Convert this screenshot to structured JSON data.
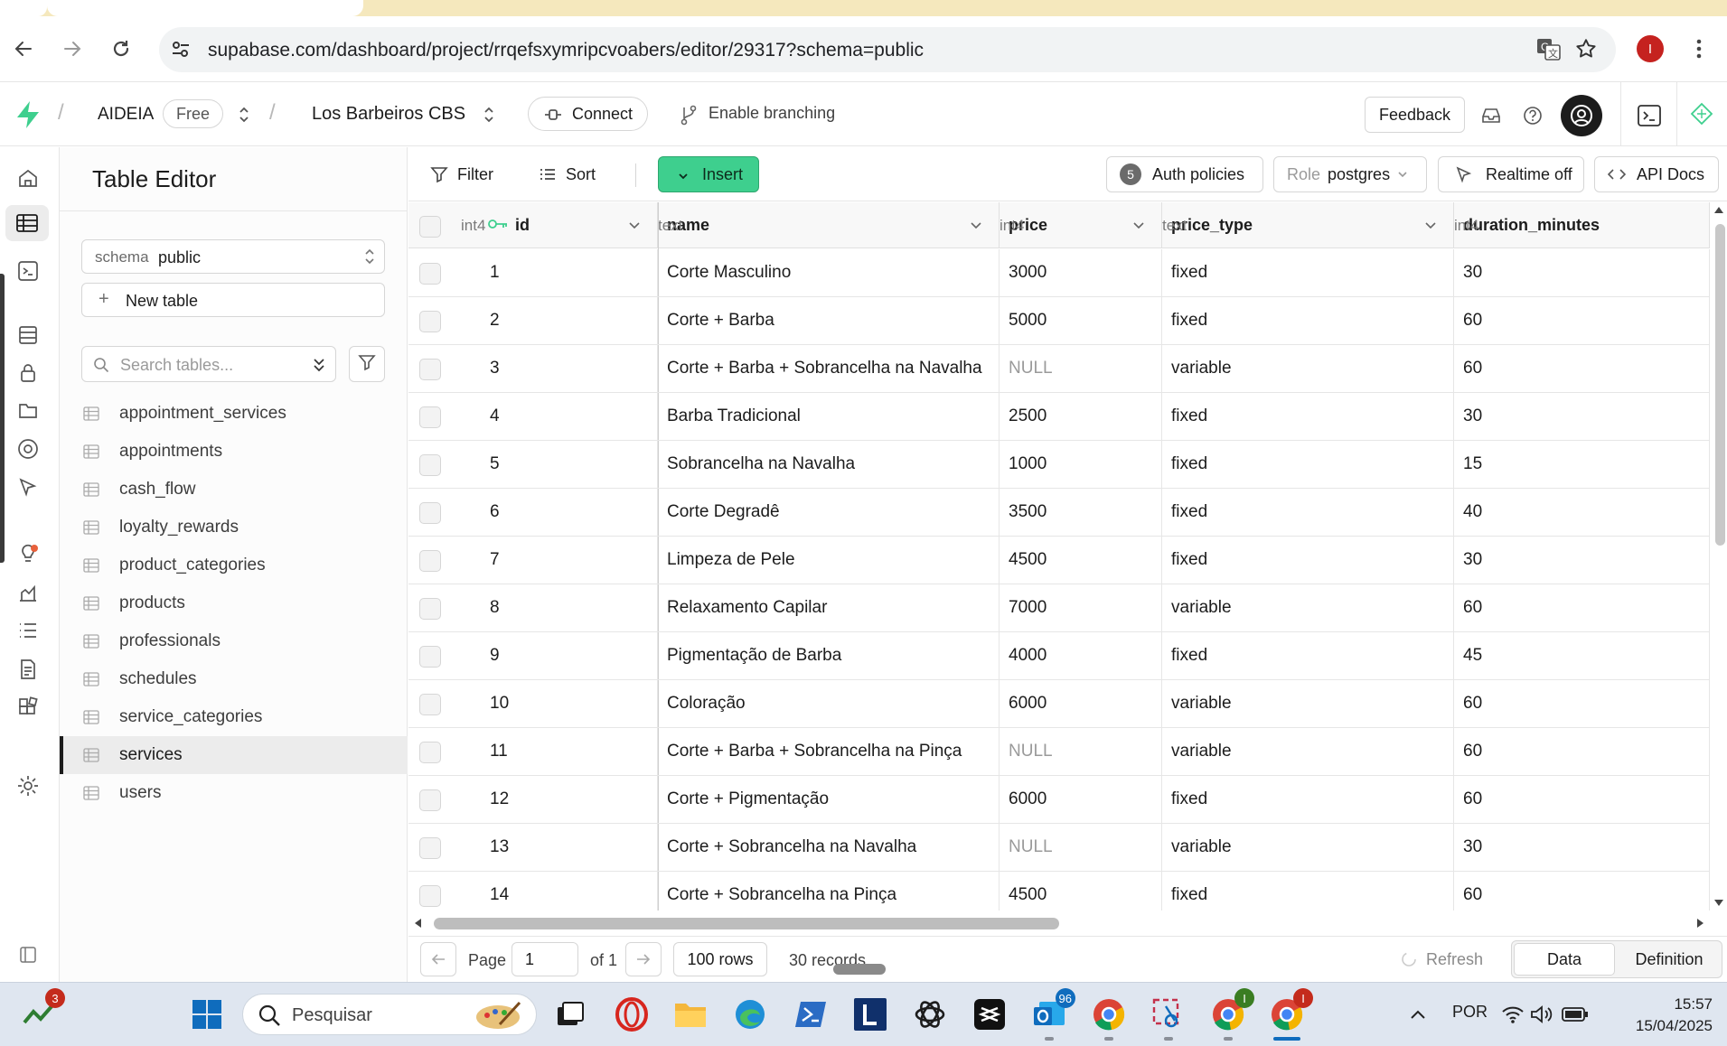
{
  "browser": {
    "url": "supabase.com/dashboard/project/rrqefsxymripcvoabers/editor/29317?schema=public",
    "profile_initial": "I"
  },
  "appbar": {
    "org": "AIDEIA",
    "plan": "Free",
    "project": "Los Barbeiros CBS",
    "connect": "Connect",
    "branching": "Enable branching",
    "feedback": "Feedback"
  },
  "sidebar": {
    "title": "Table Editor",
    "schema_label": "schema",
    "schema_value": "public",
    "new_table": "New table",
    "search_placeholder": "Search tables...",
    "tables": [
      "appointment_services",
      "appointments",
      "cash_flow",
      "loyalty_rewards",
      "product_categories",
      "products",
      "professionals",
      "schedules",
      "service_categories",
      "services",
      "users"
    ],
    "active_table": "services"
  },
  "gridbar": {
    "filter": "Filter",
    "sort": "Sort",
    "insert": "Insert",
    "auth_count": "5",
    "auth_policies": "Auth policies",
    "role_label": "Role",
    "role_value": "postgres",
    "realtime": "Realtime off",
    "api_docs": "API Docs"
  },
  "grid": {
    "columns": [
      {
        "name": "id",
        "type": "int4"
      },
      {
        "name": "name",
        "type": "text"
      },
      {
        "name": "price",
        "type": "int4"
      },
      {
        "name": "price_type",
        "type": "text"
      },
      {
        "name": "duration_minutes",
        "type": "int4"
      }
    ],
    "rows": [
      [
        "1",
        "Corte Masculino",
        "3000",
        "fixed",
        "30"
      ],
      [
        "2",
        "Corte + Barba",
        "5000",
        "fixed",
        "60"
      ],
      [
        "3",
        "Corte + Barba + Sobrancelha na Navalha",
        "NULL",
        "variable",
        "60"
      ],
      [
        "4",
        "Barba Tradicional",
        "2500",
        "fixed",
        "30"
      ],
      [
        "5",
        "Sobrancelha na Navalha",
        "1000",
        "fixed",
        "15"
      ],
      [
        "6",
        "Corte Degradê",
        "3500",
        "fixed",
        "40"
      ],
      [
        "7",
        "Limpeza de Pele",
        "4500",
        "fixed",
        "30"
      ],
      [
        "8",
        "Relaxamento Capilar",
        "7000",
        "variable",
        "60"
      ],
      [
        "9",
        "Pigmentação de Barba",
        "4000",
        "fixed",
        "45"
      ],
      [
        "10",
        "Coloração",
        "6000",
        "variable",
        "60"
      ],
      [
        "11",
        "Corte + Barba + Sobrancelha na Pinça",
        "NULL",
        "variable",
        "60"
      ],
      [
        "12",
        "Corte + Pigmentação",
        "6000",
        "fixed",
        "60"
      ],
      [
        "13",
        "Corte + Sobrancelha na Navalha",
        "NULL",
        "variable",
        "30"
      ],
      [
        "14",
        "Corte + Sobrancelha na Pinça",
        "4500",
        "fixed",
        "60"
      ]
    ]
  },
  "footer": {
    "page_label": "Page",
    "page_value": "1",
    "of_label": "of 1",
    "rows_label": "100 rows",
    "records": "30 records",
    "refresh": "Refresh",
    "tab_data": "Data",
    "tab_definition": "Definition"
  },
  "taskbar": {
    "search_placeholder": "Pesquisar",
    "badge_widget": "3",
    "badge_mail": "96",
    "badge_chrome2": "I",
    "badge_chrome3": "I",
    "lang": "POR",
    "time": "15:57",
    "date": "15/04/2025"
  },
  "colors": {
    "brand_green": "#3ecf8e",
    "null_text": "#9a9a9a",
    "accent_blue": "#0f6cbd"
  }
}
